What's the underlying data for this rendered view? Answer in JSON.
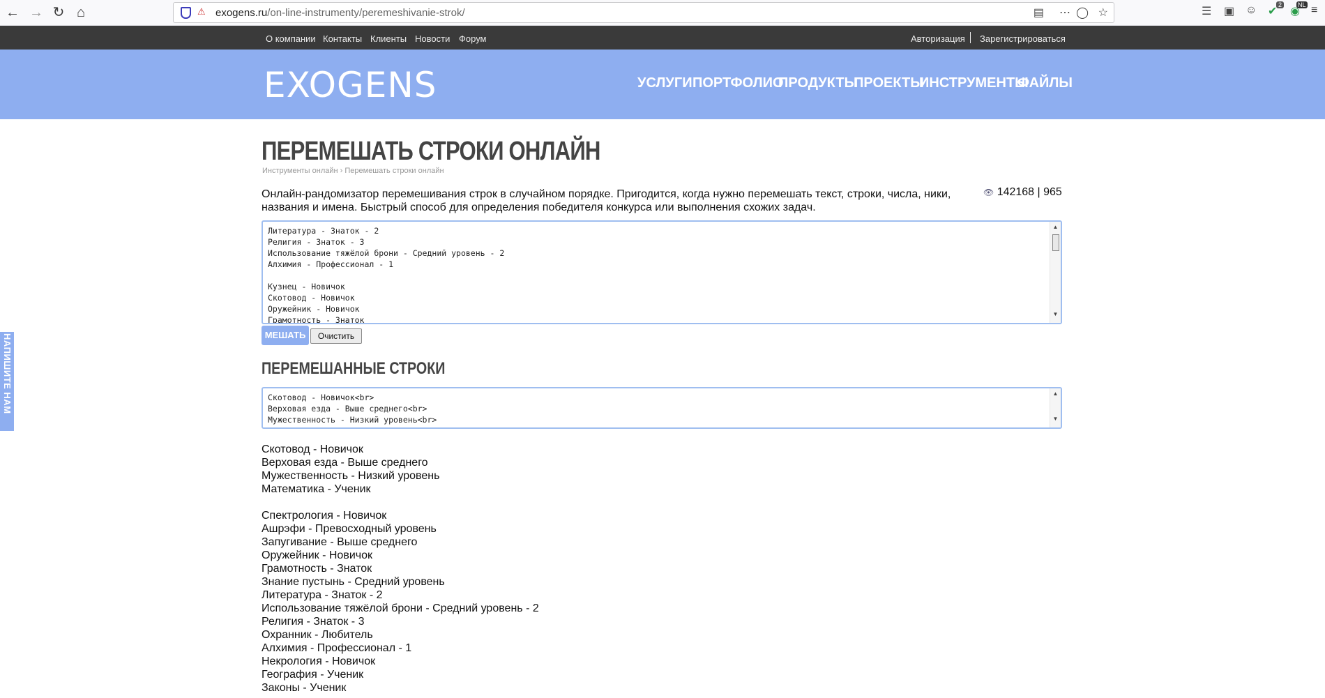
{
  "browser": {
    "url_host": "exogens.ru",
    "url_path": "/on-line-instrumenty/peremeshivanie-strok/",
    "badge_count": "2",
    "badge_lang": "NL"
  },
  "topnav": {
    "left": [
      "О компании",
      "Контакты",
      "Клиенты",
      "Новости",
      "Форум"
    ],
    "login": "Авторизация",
    "register": "Зарегистрироваться"
  },
  "header": {
    "logo": "EXOGENS",
    "menu": [
      "УСЛУГИ",
      "ПОРТФОЛИО",
      "ПРОДУКТЫ",
      "ПРОЕКТЫ",
      "ИНСТРУМЕНТЫ",
      "ФАЙЛЫ"
    ]
  },
  "page": {
    "title": "ПЕРЕМЕШАТЬ СТРОКИ ОНЛАЙН",
    "breadcrumb": "Инструменты онлайн › Перемешать строки онлайн",
    "description": "Онлайн-рандомизатор перемешивания строк в случайном порядке. Пригодится, когда нужно перемешать текст, строки, числа, ники, названия и имена. Быстрый способ для определения победителя конкурса или выполнения схожих задач.",
    "views": "142168",
    "likes": "965",
    "input_lines": "Литература - Знаток - 2\nРелигия - Знаток - 3\nИспользование тяжёлой брони - Средний уровень - 2\nАлхимия - Профессионал - 1\n\nКузнец - Новичок\nСкотовод - Новичок\nОружейник - Новичок\nГрамотность - Знаток",
    "mix_button": "МЕШАТЬ",
    "clear_button": "Очистить",
    "result_title": "ПЕРЕМЕШАННЫЕ СТРОКИ",
    "result_html": "Скотовод - Новичок<br>\nВерховая езда - Выше среднего<br>\nМужественность - Низкий уровень<br>",
    "result_text": "Скотовод - Новичок\nВерховая езда - Выше среднего\nМужественность - Низкий уровень\nМатематика - Ученик\n\nСпектрология - Новичок\nАшрэфи - Превосходный уровень\nЗапугивание - Выше среднего\nОружейник - Новичок\nГрамотность - Знаток\nЗнание пустынь - Средний уровень\nЛитература - Знаток - 2\nИспользование тяжёлой брони - Средний уровень - 2\nРелигия - Знаток - 3\nОхранник - Любитель\nАлхимия - Профессионал - 1\nНекрология - Новичок\nГеография - Ученик\nЗаконы - Ученик"
  },
  "side_tab": "НАПИШИТЕ НАМ"
}
